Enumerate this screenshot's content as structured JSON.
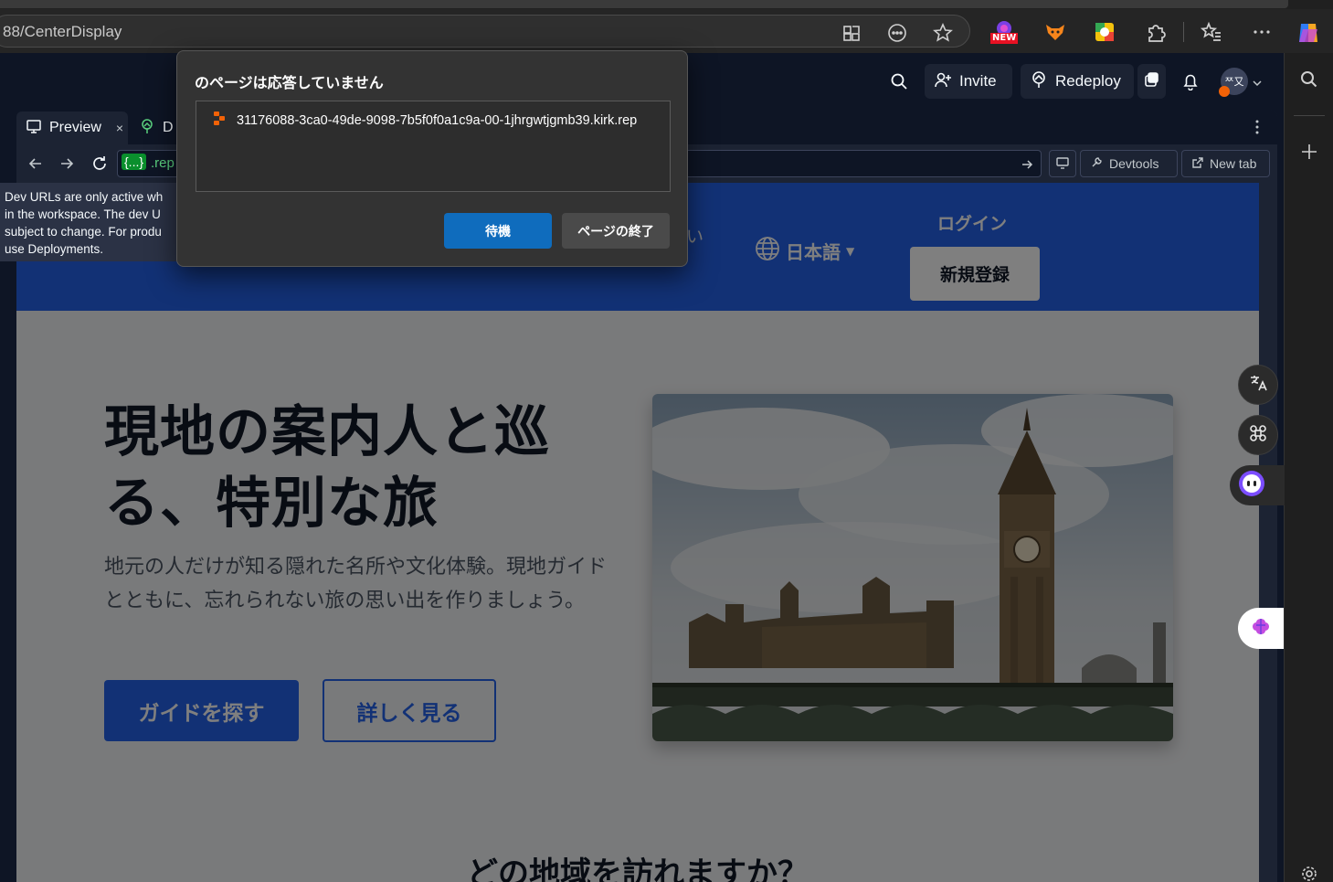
{
  "browser": {
    "url": "88/CenterDisplay",
    "new_badge": "NEW"
  },
  "ide": {
    "invite_label": "Invite",
    "redeploy_label": "Redeploy",
    "avatar_text": "ᄍ又",
    "tabs": [
      {
        "label": "Preview"
      },
      {
        "label": "D"
      }
    ],
    "url_prefix": "{...}",
    "url_rest": ".rep",
    "devtools_label": "Devtools",
    "newtab_label": "New tab"
  },
  "tooltip": {
    "lines": [
      "Dev URLs are only active wh",
      "in the workspace. The dev U",
      "subject to change. For produ",
      "use Deployments."
    ]
  },
  "dialog": {
    "title": "のページは応答していません",
    "item": "31176088-3ca0-49de-9098-7b5f0f0a1c9a-00-1jhrgwtjgmb39.kirk.rep",
    "wait_label": "待機",
    "end_label": "ページの終了"
  },
  "site": {
    "nav_partial": "い",
    "language": "日本語",
    "login": "ログイン",
    "signup": "新規登録",
    "hero_title": "現地の案内人と巡る、特別な旅",
    "hero_subtitle": "地元の人だけが知る隠れた名所や文化体験。現地ガイドとともに、忘れられない旅の思い出を作りましょう。",
    "primary_button": "ガイドを探す",
    "secondary_button": "詳しく見る",
    "section_title": "どの地域を訪れますか？"
  },
  "colors": {
    "site_accent": "#2563eb",
    "dialog_primary": "#0f6cbd",
    "ide_bg": "#0e1525"
  }
}
